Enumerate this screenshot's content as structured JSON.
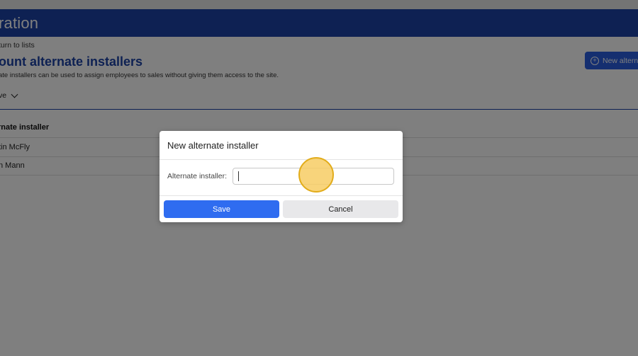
{
  "banner": {
    "title": "ration"
  },
  "page": {
    "return_link": "turn to lists",
    "heading": "ount alternate installers",
    "description": "ate installers can be used to assign employees to sales without giving them access to the site.",
    "new_button_label": "New altern",
    "filter_label": "ve"
  },
  "table": {
    "header": "rnate installer",
    "rows": [
      "tin McFly",
      "n Mann"
    ]
  },
  "modal": {
    "title": "New alternate installer",
    "field_label": "Alternate installer:",
    "field_value": "",
    "save_label": "Save",
    "cancel_label": "Cancel"
  },
  "colors": {
    "brand": "#1d43a6",
    "primary_button": "#2f6cf0",
    "click_marker": "#f7cd64"
  },
  "icons": {
    "new_button": "plus-circle-icon",
    "filter": "chevron-down-icon"
  }
}
